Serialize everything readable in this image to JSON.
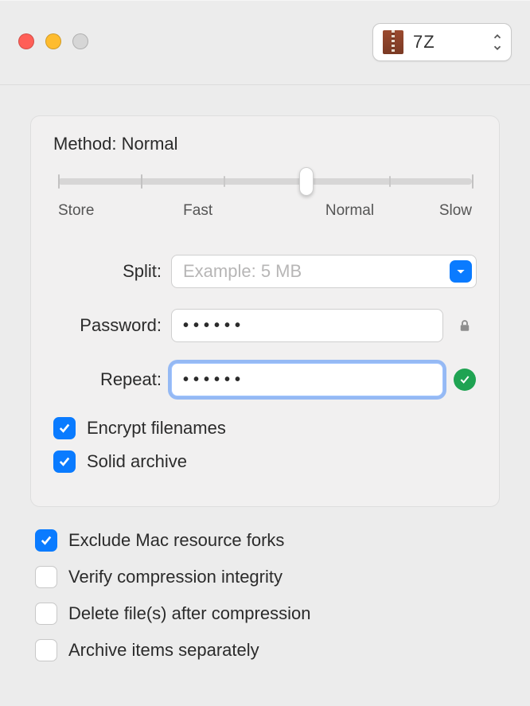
{
  "titlebar": {
    "format_label": "7Z"
  },
  "panel": {
    "method_label_prefix": "Method:",
    "method_value": "Normal",
    "slider": {
      "labels": [
        "Store",
        "Fast",
        "Normal",
        "Slow"
      ]
    },
    "split": {
      "label": "Split:",
      "placeholder": "Example: 5 MB",
      "value": ""
    },
    "password": {
      "label": "Password:",
      "value": "••••••"
    },
    "repeat": {
      "label": "Repeat:",
      "value": "••••••"
    },
    "encrypt_filenames": {
      "label": "Encrypt filenames",
      "checked": true
    },
    "solid_archive": {
      "label": "Solid archive",
      "checked": true
    }
  },
  "outside": {
    "exclude_resource_forks": {
      "label": "Exclude Mac resource forks",
      "checked": true
    },
    "verify_integrity": {
      "label": "Verify compression integrity",
      "checked": false
    },
    "delete_after": {
      "label": "Delete file(s) after compression",
      "checked": false
    },
    "archive_separately": {
      "label": "Archive items separately",
      "checked": false
    }
  }
}
